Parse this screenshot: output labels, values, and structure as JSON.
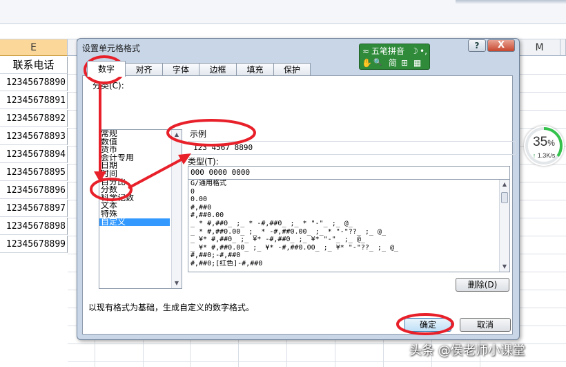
{
  "sheet": {
    "columns": {
      "e": "E",
      "m": "M"
    },
    "header_cell": "联系电话",
    "phone_cells": [
      "12345678890",
      "12345678891",
      "12345678892",
      "12345678893",
      "12345678894",
      "12345678895",
      "12345678896",
      "12345678897",
      "12345678898",
      "12345678899"
    ]
  },
  "speed_widget": {
    "percent": "35",
    "percent_sign": "%",
    "rate": "1.3K/s",
    "progress": 0.35
  },
  "dialog": {
    "title": "设置单元格格式",
    "help_glyph": "?",
    "close_glyph": "X",
    "tabs": [
      "数字",
      "对齐",
      "字体",
      "边框",
      "填充",
      "保护"
    ],
    "active_tab": 0,
    "category_label": "分类(C):",
    "categories": [
      "常规",
      "数值",
      "货币",
      "会计专用",
      "日期",
      "时间",
      "百分比",
      "分数",
      "科学记数",
      "文本",
      "特殊",
      "自定义"
    ],
    "selected_category": 11,
    "sample_label": "示例",
    "sample_value": "123 4567 8890",
    "type_label": "类型(T):",
    "type_value": "000 0000 0000",
    "format_codes": [
      "G/通用格式",
      "0",
      "0.00",
      "#,##0",
      "#,##0.00",
      "_ * #,##0_ ;_ * -#,##0_ ;_ * \"-\"_ ;_ @_",
      "_ * #,##0.00_ ;_ * -#,##0.00_ ;_ * \"-\"??_ ;_ @_",
      "_ ¥* #,##0_ ;_ ¥* -#,##0_ ;_ ¥* \"-\"_ ;_ @_",
      "_ ¥* #,##0.00_ ;_ ¥* -#,##0.00_ ;_ ¥* \"-\"??_ ;_ @_",
      "#,##0;-#,##0",
      "#,##0;[红色]-#,##0"
    ],
    "delete_button": "删除(D)",
    "description": "以现有格式为基础，生成自定义的数字格式。",
    "ok_button": "确定",
    "cancel_button": "取消"
  },
  "ime": {
    "row1": [
      "≈",
      "五笔拼音",
      "☽",
      "•,"
    ],
    "row2": [
      "✋",
      "🔍",
      "简",
      "⊞",
      "▦"
    ]
  },
  "annotation_color": "#e8202a",
  "watermark": "头条 @侯老师小课堂"
}
